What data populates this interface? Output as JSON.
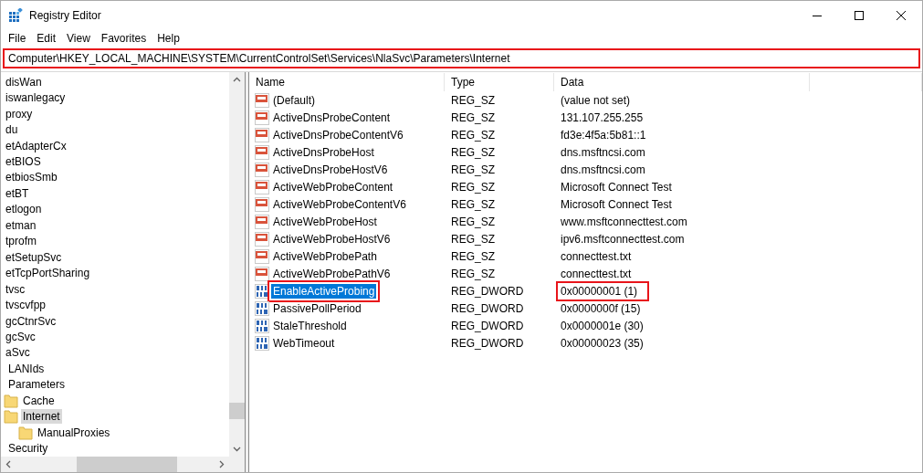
{
  "window": {
    "title": "Registry Editor"
  },
  "menu": [
    {
      "label": "File"
    },
    {
      "label": "Edit"
    },
    {
      "label": "View"
    },
    {
      "label": "Favorites"
    },
    {
      "label": "Help"
    }
  ],
  "address_bar": {
    "value": "Computer\\HKEY_LOCAL_MACHINE\\SYSTEM\\CurrentControlSet\\Services\\NlaSvc\\Parameters\\Internet",
    "highlighted": true
  },
  "tree": [
    {
      "label": "disWan",
      "selected": false
    },
    {
      "label": "iswanlegacy",
      "selected": false
    },
    {
      "label": "proxy",
      "selected": false
    },
    {
      "label": "du",
      "selected": false
    },
    {
      "label": "etAdapterCx",
      "selected": false
    },
    {
      "label": "etBIOS",
      "selected": false
    },
    {
      "label": "etbiosSmb",
      "selected": false
    },
    {
      "label": "etBT",
      "selected": false
    },
    {
      "label": "etlogon",
      "selected": false
    },
    {
      "label": "etman",
      "selected": false
    },
    {
      "label": "tprofm",
      "selected": false
    },
    {
      "label": "etSetupSvc",
      "selected": false
    },
    {
      "label": "etTcpPortSharing",
      "selected": false
    },
    {
      "label": "tvsc",
      "selected": false
    },
    {
      "label": "tvscvfpp",
      "selected": false
    },
    {
      "label": "gcCtnrSvc",
      "selected": false
    },
    {
      "label": "gcSvc",
      "selected": false
    },
    {
      "label": "aSvc",
      "selected": false,
      "children": [
        {
          "label": "LANIds",
          "selected": false
        },
        {
          "label": "Parameters",
          "selected": false,
          "children": [
            {
              "label": "Cache",
              "selected": false
            },
            {
              "label": "Internet",
              "selected": true,
              "children": [
                {
                  "label": "ManualProxies",
                  "selected": false
                }
              ]
            }
          ]
        },
        {
          "label": "Security",
          "selected": false
        }
      ]
    }
  ],
  "table": {
    "columns": [
      "Name",
      "Type",
      "Data"
    ],
    "rows": [
      {
        "kind": "string",
        "name": "(Default)",
        "type": "REG_SZ",
        "data": "(value not set)",
        "selected": false,
        "highlighted": false
      },
      {
        "kind": "string",
        "name": "ActiveDnsProbeContent",
        "type": "REG_SZ",
        "data": "131.107.255.255",
        "selected": false,
        "highlighted": false
      },
      {
        "kind": "string",
        "name": "ActiveDnsProbeContentV6",
        "type": "REG_SZ",
        "data": "fd3e:4f5a:5b81::1",
        "selected": false,
        "highlighted": false
      },
      {
        "kind": "string",
        "name": "ActiveDnsProbeHost",
        "type": "REG_SZ",
        "data": "dns.msftncsi.com",
        "selected": false,
        "highlighted": false
      },
      {
        "kind": "string",
        "name": "ActiveDnsProbeHostV6",
        "type": "REG_SZ",
        "data": "dns.msftncsi.com",
        "selected": false,
        "highlighted": false
      },
      {
        "kind": "string",
        "name": "ActiveWebProbeContent",
        "type": "REG_SZ",
        "data": "Microsoft Connect Test",
        "selected": false,
        "highlighted": false
      },
      {
        "kind": "string",
        "name": "ActiveWebProbeContentV6",
        "type": "REG_SZ",
        "data": "Microsoft Connect Test",
        "selected": false,
        "highlighted": false
      },
      {
        "kind": "string",
        "name": "ActiveWebProbeHost",
        "type": "REG_SZ",
        "data": "www.msftconnecttest.com",
        "selected": false,
        "highlighted": false
      },
      {
        "kind": "string",
        "name": "ActiveWebProbeHostV6",
        "type": "REG_SZ",
        "data": "ipv6.msftconnecttest.com",
        "selected": false,
        "highlighted": false
      },
      {
        "kind": "string",
        "name": "ActiveWebProbePath",
        "type": "REG_SZ",
        "data": "connecttest.txt",
        "selected": false,
        "highlighted": false
      },
      {
        "kind": "string",
        "name": "ActiveWebProbePathV6",
        "type": "REG_SZ",
        "data": "connecttest.txt",
        "selected": false,
        "highlighted": false
      },
      {
        "kind": "dword",
        "name": "EnableActiveProbing",
        "type": "REG_DWORD",
        "data": "0x00000001 (1)",
        "selected": true,
        "highlighted": true
      },
      {
        "kind": "dword",
        "name": "PassivePollPeriod",
        "type": "REG_DWORD",
        "data": "0x0000000f (15)",
        "selected": false,
        "highlighted": false
      },
      {
        "kind": "dword",
        "name": "StaleThreshold",
        "type": "REG_DWORD",
        "data": "0x0000001e (30)",
        "selected": false,
        "highlighted": false
      },
      {
        "kind": "dword",
        "name": "WebTimeout",
        "type": "REG_DWORD",
        "data": "0x00000023 (35)",
        "selected": false,
        "highlighted": false
      }
    ]
  }
}
